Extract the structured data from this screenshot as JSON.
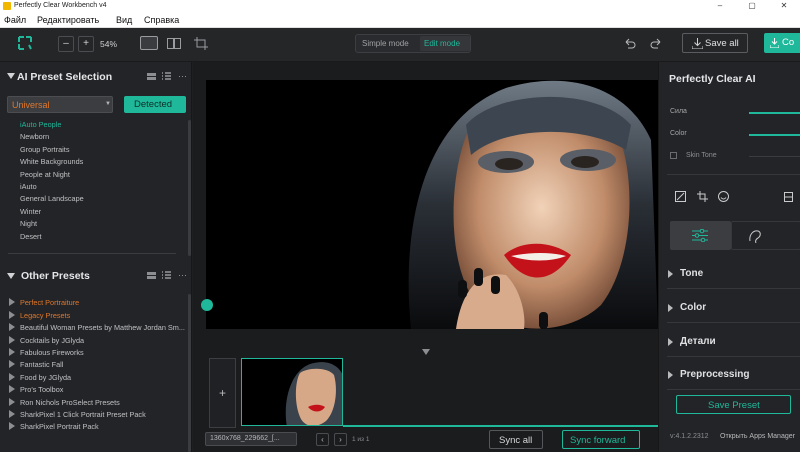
{
  "window": {
    "title": "Perfectly Clear Workbench v4",
    "controls": [
      "–",
      "▢",
      "✕"
    ]
  },
  "menu": [
    "Файл",
    "Редактировать",
    "Вид",
    "Справка"
  ],
  "toolbar": {
    "zoom_minus": "–",
    "zoom_plus": "+",
    "zoom_value": "54%",
    "mode_simple": "Simple mode",
    "mode_edit": "Edit mode",
    "save_all": "Save all",
    "export": "Co"
  },
  "left": {
    "ai_title": "AI Preset Selection",
    "select_value": "Universal",
    "detected_button": "Detected",
    "ai_presets": [
      "iAuto People",
      "Newborn",
      "Group Portraits",
      "White Backgrounds",
      "People at Night",
      "iAuto",
      "General Landscape",
      "Winter",
      "Night",
      "Desert"
    ],
    "other_title": "Other Presets",
    "other_presets": [
      "Perfect Portraiture",
      "Legacy Presets",
      "Beautiful Woman Presets by Matthew Jordan Sm...",
      "Cocktails by JGlyda",
      "Fabulous Fireworks",
      "Fantastic Fall",
      "Food by JGlyda",
      "Pro's Toolbox",
      "Ron Nichols ProSelect Presets",
      "SharkPixel 1 Click Portrait Preset Pack",
      "SharkPixel Portrait Pack"
    ],
    "more": "···"
  },
  "bottom": {
    "add": "+",
    "resolution": "1360x768_229662_[...",
    "pager": "1 из 1",
    "sync_all": "Sync all",
    "sync_forward": "Sync forward"
  },
  "right": {
    "title": "Perfectly Clear AI",
    "sliders": [
      {
        "label": "Сила",
        "level": 0.64
      },
      {
        "label": "Color",
        "level": 0.64
      }
    ],
    "skin_tone": "Skin Tone",
    "sections": [
      "Tone",
      "Color",
      "Детали",
      "Preprocessing"
    ],
    "save_preset": "Save Preset",
    "version": "v:4.1.2.2312",
    "apps_manager": "Открыть Apps Manager"
  },
  "colors": {
    "accent": "#1fb89a",
    "orange": "#e0772b",
    "bg": "#1e1f21",
    "lips": "#c4121b"
  }
}
